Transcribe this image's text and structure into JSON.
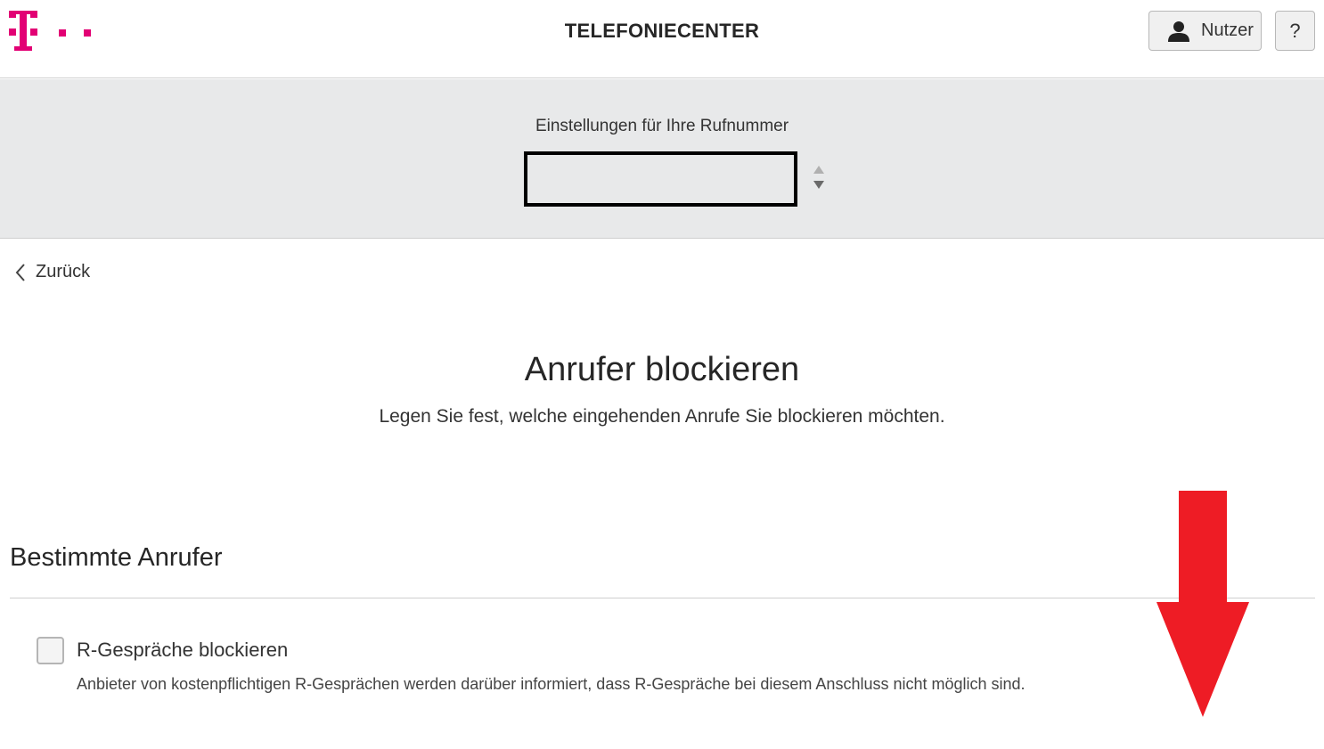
{
  "header": {
    "logo_icon": "telekom-t-logo-icon",
    "brand_color": "#e20074",
    "title": "TELEFONIECENTER",
    "user_button_label": "Nutzer",
    "user_icon": "user-icon",
    "help_button_label": "?"
  },
  "number_band": {
    "label": "Einstellungen für Ihre Rufnummer",
    "selected_number": "",
    "arrows_icon": "select-up-down-icon",
    "background": "#e8e9ea"
  },
  "navigation": {
    "back_label": "Zurück",
    "back_icon": "chevron-left-icon"
  },
  "main": {
    "title": "Anrufer blockieren",
    "subtitle": "Legen Sie fest, welche eingehenden Anrufe Sie blockieren möchten."
  },
  "section": {
    "title": "Bestimmte Anrufer",
    "options": [
      {
        "label": "R-Gespräche blockieren",
        "description": "Anbieter von kostenpflichtigen R-Gesprächen werden darüber informiert, dass R-Gespräche bei diesem Anschluss nicht möglich sind.",
        "checked": false
      }
    ]
  },
  "annotation": {
    "icon": "red-down-arrow-icon",
    "color": "#ee1c25"
  }
}
